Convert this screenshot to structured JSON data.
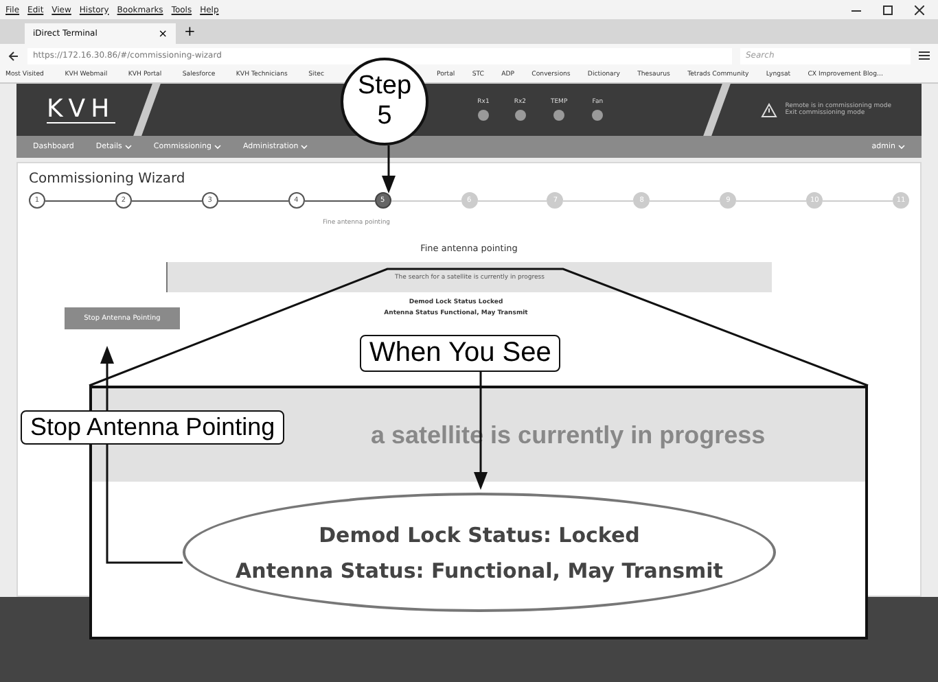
{
  "browser": {
    "menu": [
      "File",
      "Edit",
      "View",
      "History",
      "Bookmarks",
      "Tools",
      "Help"
    ],
    "tab": {
      "title": "iDirect Terminal",
      "close": "×",
      "new": "+"
    },
    "url": "https://172.16.30.86/#/commissioning-wizard",
    "search_placeholder": "Search",
    "bookmarks_left": [
      "Most Visited",
      "KVH Webmail",
      "KVH Portal",
      "Salesforce",
      "KVH Technicians",
      "Sitec"
    ],
    "bookmarks_right": [
      "Portal",
      "STC",
      "ADP",
      "Conversions",
      "Dictionary",
      "Thesaurus",
      "Tetrads Community",
      "Lyngsat",
      "CX Improvement Blog..."
    ]
  },
  "header": {
    "logo": "KVH",
    "indicators": [
      "Rx1",
      "Rx2",
      "TEMP",
      "Fan"
    ],
    "notice": {
      "title": "Remote is in commissioning mode",
      "link": "Exit commissioning mode"
    }
  },
  "nav": {
    "items": [
      {
        "label": "Dashboard",
        "has_menu": false
      },
      {
        "label": "Details",
        "has_menu": true
      },
      {
        "label": "Commissioning",
        "has_menu": true
      },
      {
        "label": "Administration",
        "has_menu": true
      }
    ],
    "user": "admin"
  },
  "wizard": {
    "title": "Commissioning Wizard",
    "step_label": "Fine antenna pointing",
    "steps": [
      {
        "number": "1",
        "selected": false,
        "completed": true
      },
      {
        "number": "2",
        "selected": false,
        "completed": true
      },
      {
        "number": "3",
        "selected": false,
        "completed": true
      },
      {
        "number": "4",
        "selected": false,
        "completed": true
      },
      {
        "number": "5",
        "selected": true,
        "completed": false
      },
      {
        "number": "6",
        "selected": false,
        "completed": false
      },
      {
        "number": "7",
        "selected": false,
        "completed": false
      },
      {
        "number": "8",
        "selected": false,
        "completed": false
      },
      {
        "number": "9",
        "selected": false,
        "completed": false
      },
      {
        "number": "10",
        "selected": false,
        "completed": false
      },
      {
        "number": "11",
        "selected": false,
        "completed": false
      }
    ]
  },
  "panel": {
    "heading": "Fine antenna pointing",
    "alert": "The search for a satellite is currently in progress",
    "status_lines": [
      "Demod Lock Status Locked",
      "Antenna Status Functional, May Transmit"
    ],
    "button": "Stop Antenna Pointing"
  },
  "annotations": {
    "step_callout": [
      "Step",
      "5"
    ],
    "when_label": "When You See",
    "stop_label": "Stop Antenna Pointing",
    "inset": {
      "alert_fragment": "a satellite is currently in progress",
      "status_lines": [
        "Demod Lock Status: Locked",
        "Antenna Status: Functional, May Transmit"
      ]
    }
  }
}
